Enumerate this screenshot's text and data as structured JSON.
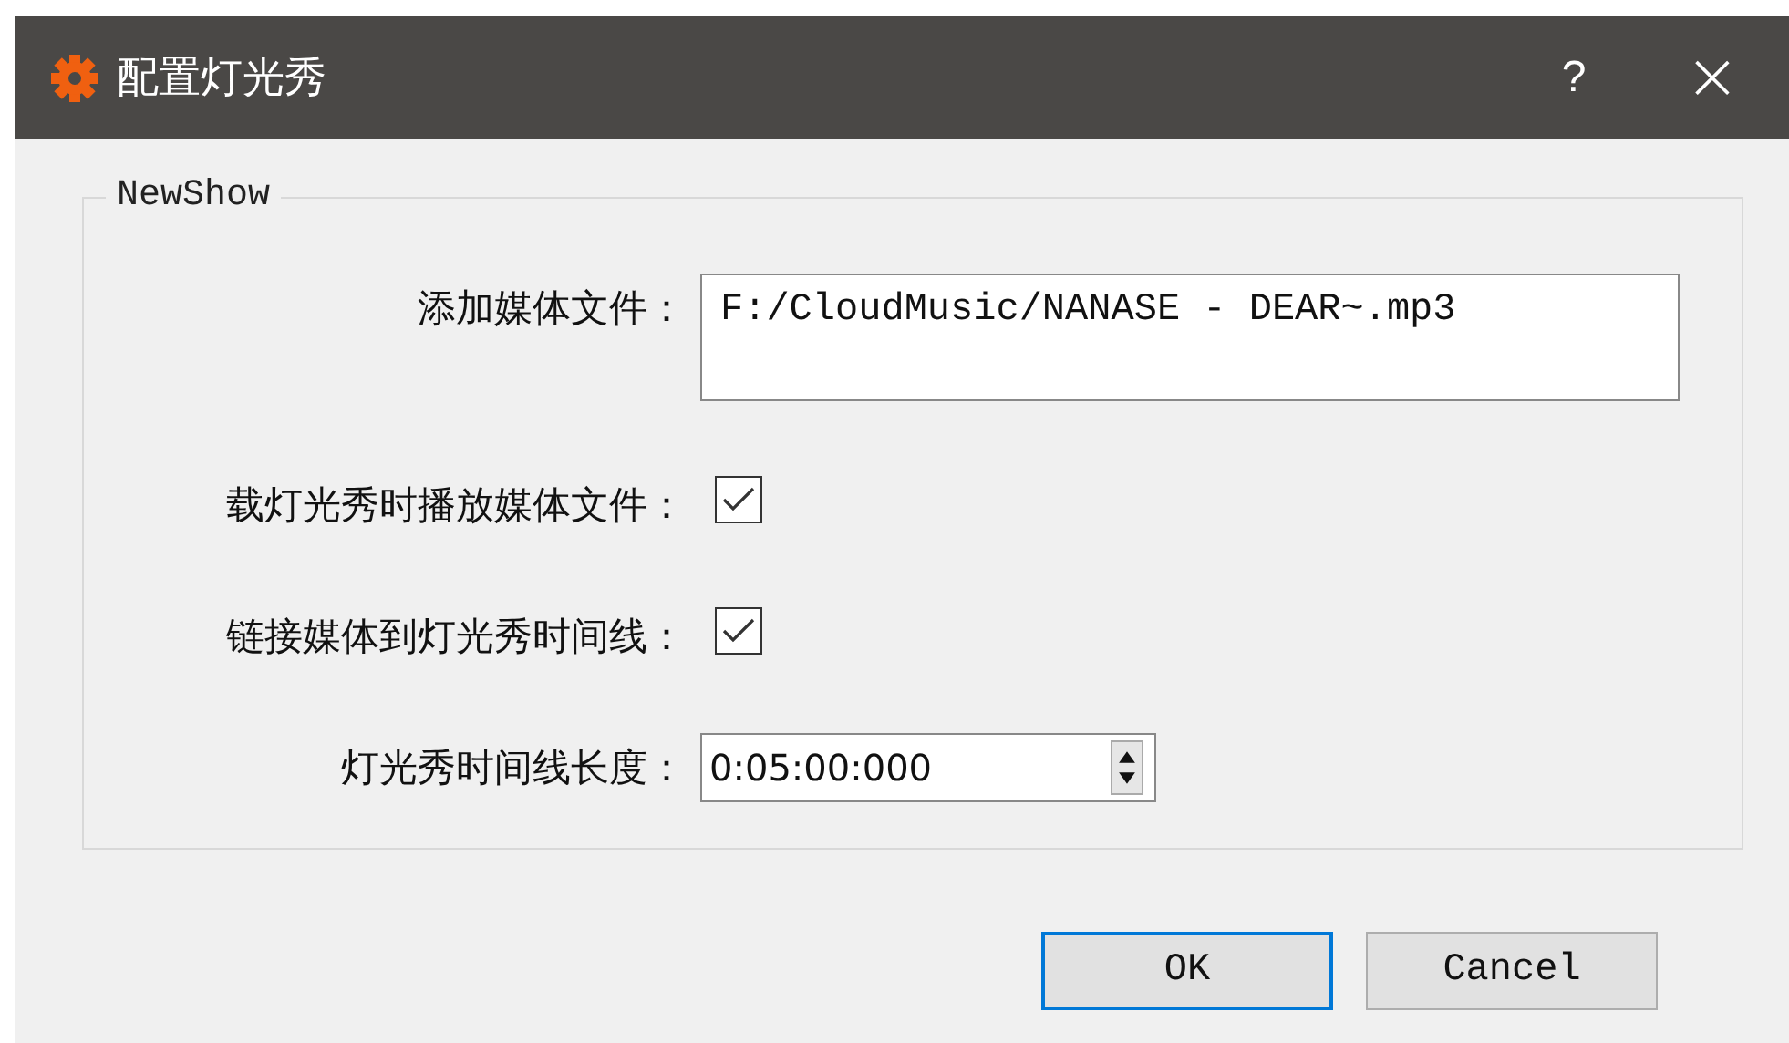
{
  "window": {
    "title": "配置灯光秀",
    "help": "?",
    "close": "×"
  },
  "group": {
    "title": "NewShow",
    "fields": [
      {
        "kind": "text",
        "label": "添加媒体文件：",
        "value": "F:/CloudMusic/NANASE - DEAR~.mp3"
      },
      {
        "kind": "checkbox",
        "label": "载灯光秀时播放媒体文件：",
        "checked": true
      },
      {
        "kind": "checkbox",
        "label": "链接媒体到灯光秀时间线：",
        "checked": true
      },
      {
        "kind": "spin",
        "label": "灯光秀时间线长度：",
        "value": "0:05:00:000"
      }
    ]
  },
  "buttons": [
    {
      "label": "OK",
      "selected": true
    },
    {
      "label": "Cancel",
      "selected": false
    }
  ]
}
